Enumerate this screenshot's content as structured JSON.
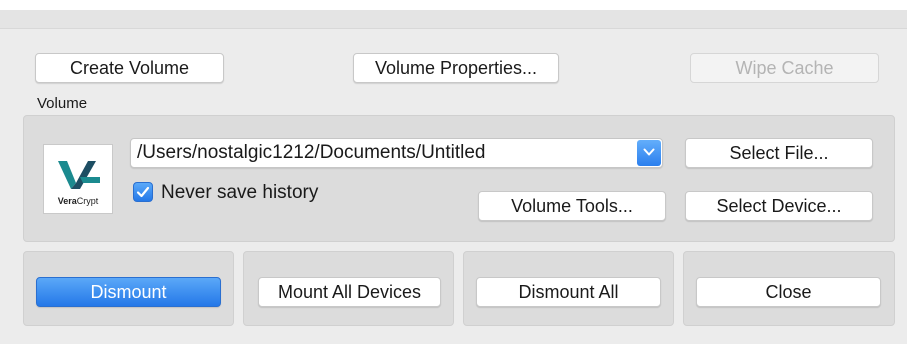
{
  "toolbar": {
    "create_volume": "Create Volume",
    "volume_properties": "Volume Properties...",
    "wipe_cache": "Wipe Cache"
  },
  "volume": {
    "section_label": "Volume",
    "path": "/Users/nostalgic1212/Documents/Untitled",
    "never_save_history": "Never save history",
    "never_save_history_checked": true,
    "select_file": "Select File...",
    "select_device": "Select Device...",
    "volume_tools": "Volume Tools...",
    "logo_text_bold": "Vera",
    "logo_text_rest": "Crypt"
  },
  "actions": {
    "dismount": "Dismount",
    "mount_all_devices": "Mount All Devices",
    "dismount_all": "Dismount All",
    "close": "Close"
  },
  "colors": {
    "accent": "#2478e8",
    "logo_teal": "#1b8a8f",
    "logo_dark": "#1d4e63"
  },
  "icons": {
    "dropdown": "chevron-down-icon",
    "checkbox": "checkmark-icon",
    "logo": "veracrypt-logo-icon"
  }
}
